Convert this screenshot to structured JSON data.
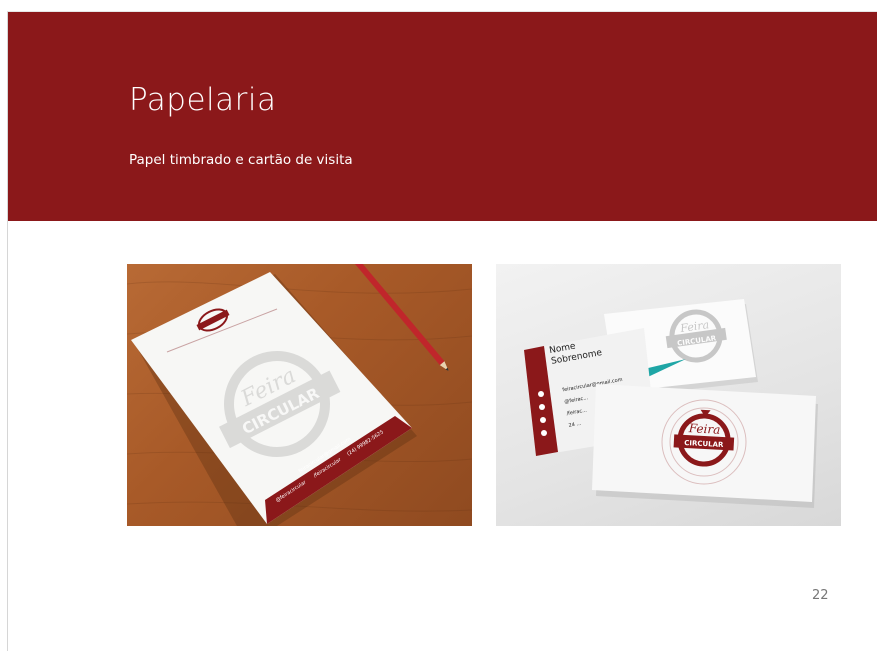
{
  "slide": {
    "title": "Papelaria",
    "subtitle": "Papel timbrado e cartão de visita",
    "page_number": "22"
  },
  "colors": {
    "brand_red": "#8b181a",
    "teal_accent": "#1fa6a6",
    "wood": "#a85a28"
  },
  "letterhead_photo": {
    "logo_text_top": "Feira",
    "logo_text_bottom": "CIRCULAR",
    "footer_email": "feiracircular@gmail.com",
    "footer_instagram": "@feiracircular",
    "footer_facebook": "/feiracircular",
    "footer_whatsapp": "(24) 99982-5625"
  },
  "business_card_photo": {
    "name_line1": "Nome",
    "name_line2": "Sobrenome",
    "email": "feiracircular@gmail.com",
    "instagram": "@feirac...",
    "facebook": "/feirac...",
    "whatsapp": "24 ...",
    "logo_text_top": "Feira",
    "logo_text_bottom": "CIRCULAR"
  }
}
